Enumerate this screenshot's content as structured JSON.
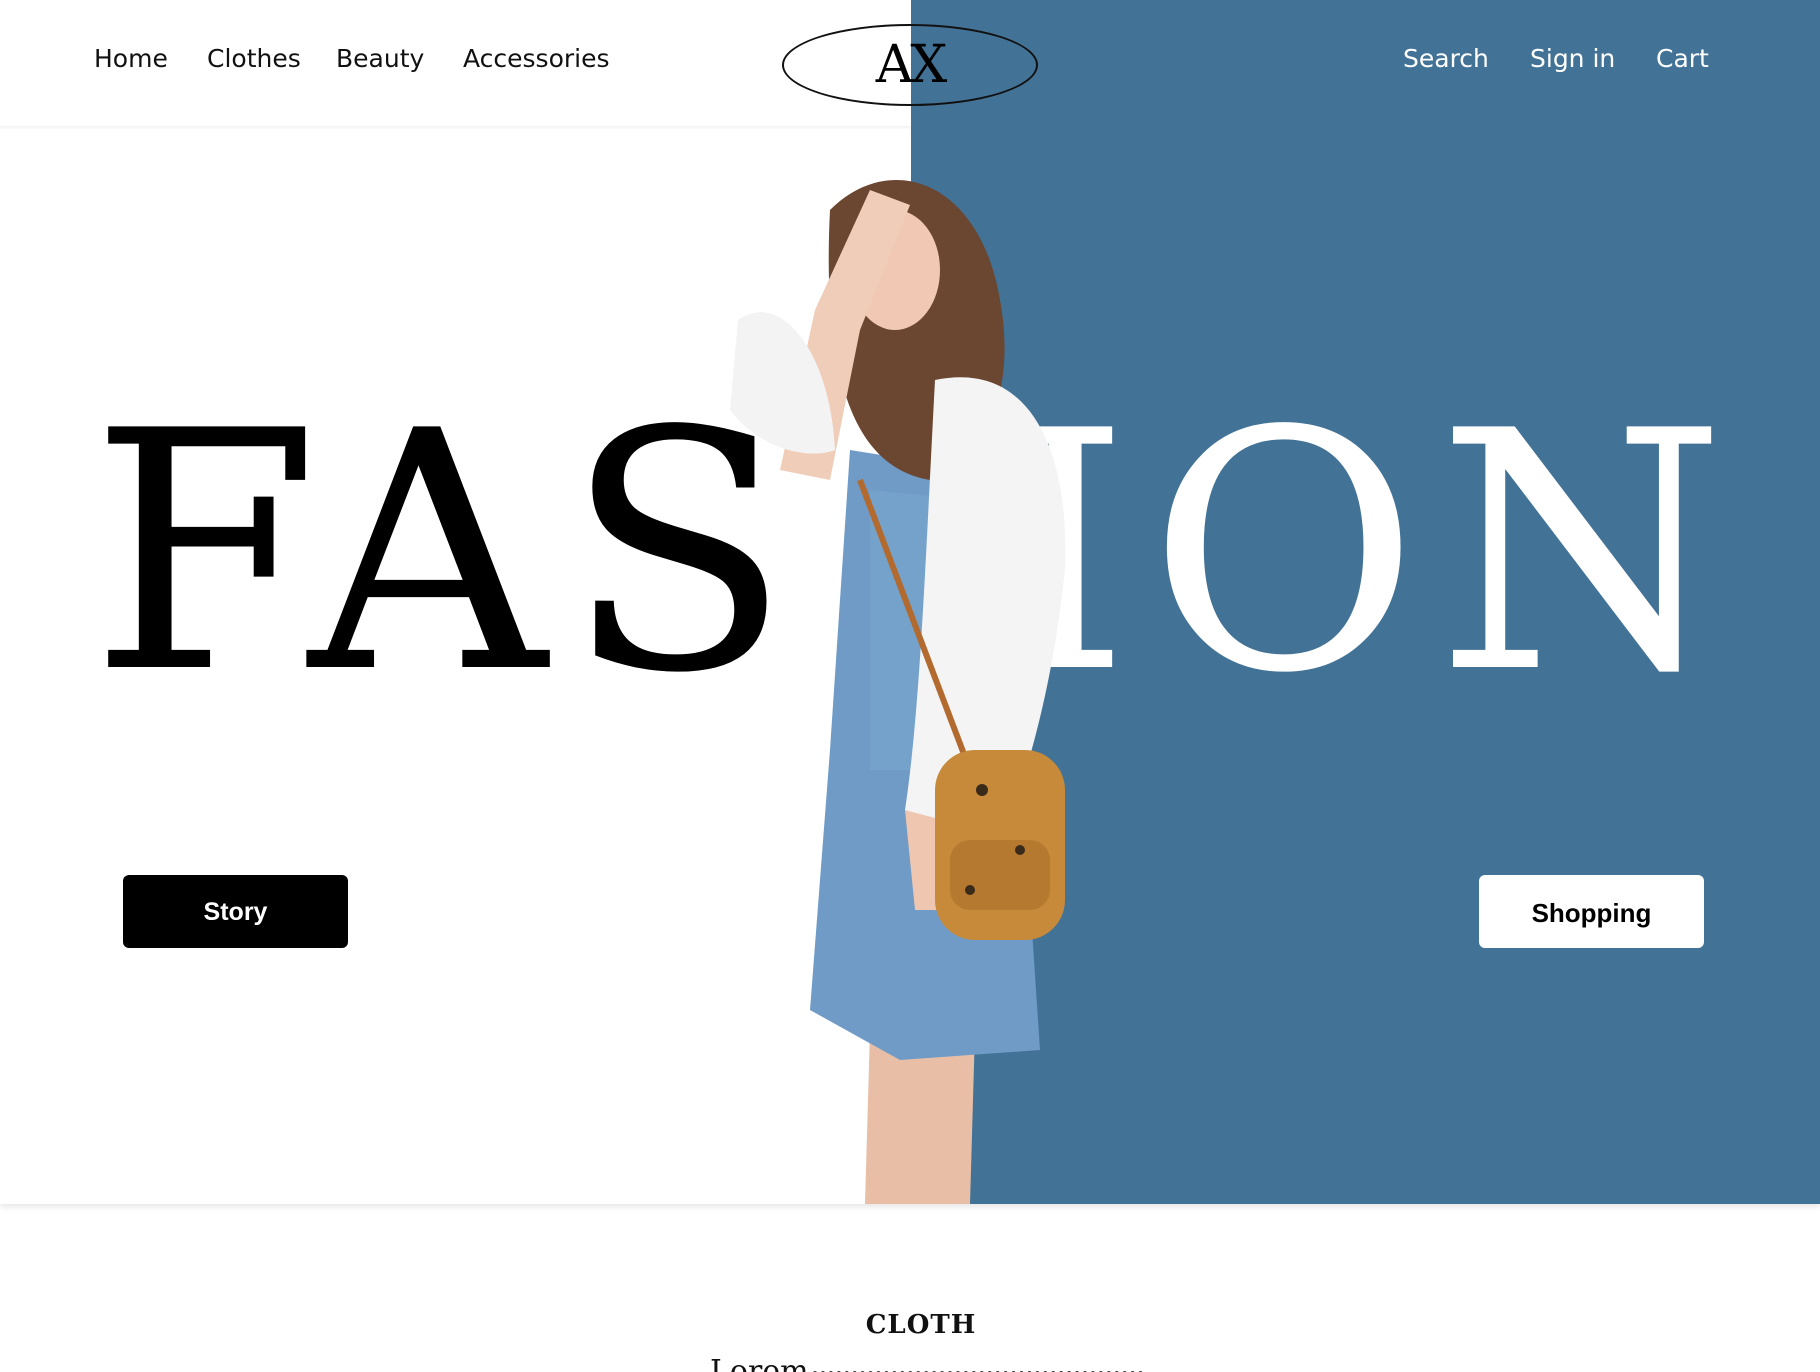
{
  "colors": {
    "accent_blue": "#427396",
    "background": "#ffffff",
    "text_dark": "#111111"
  },
  "nav": {
    "left_items": [
      {
        "label": "Home"
      },
      {
        "label": "Clothes"
      },
      {
        "label": "Beauty"
      },
      {
        "label": "Accessories"
      }
    ],
    "logo_text": "AX",
    "right_items": [
      {
        "label": "Search"
      },
      {
        "label": "Sign in"
      },
      {
        "label": "Cart"
      }
    ]
  },
  "hero": {
    "headline_left": "FAS",
    "headline_right": "ION",
    "story_button": "Story",
    "shopping_button": "Shopping",
    "image_icon": "model-photo"
  },
  "section": {
    "title": "CLOTH",
    "text": "Lorem"
  }
}
